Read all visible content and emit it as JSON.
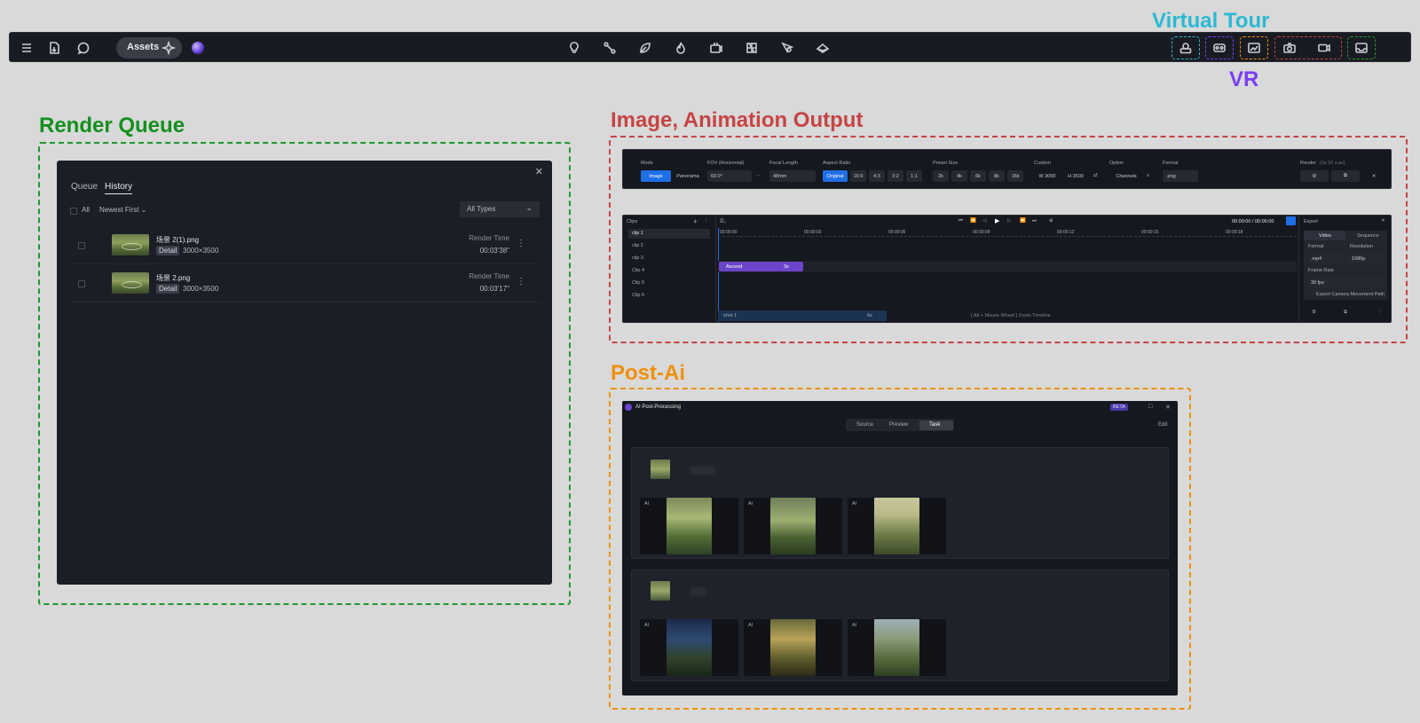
{
  "toolbar": {
    "assets_label": "Assets",
    "left_icons": [
      "menu-icon",
      "import-file-icon",
      "chat-icon",
      "sparkle-icon"
    ],
    "center_icons": [
      "light-bulb-icon",
      "path-icon",
      "leaf-icon",
      "flame-icon",
      "camera-move-icon",
      "grid-icon",
      "pin-icon",
      "layers-icon"
    ],
    "right_icons": [
      "virtual-tour-icon",
      "vr-icon",
      "share-image-icon",
      "camera-icon",
      "video-icon",
      "inbox-icon"
    ]
  },
  "annotations": {
    "virtual_tour": "Virtual Tour",
    "vr": "VR",
    "render_queue": "Render Queue",
    "image_animation": "Image, Animation Output",
    "post_ai": "Post-Ai"
  },
  "colors": {
    "virtual_tour": "#2bb9d4",
    "vr": "#7b3ff2",
    "render_queue": "#14901f",
    "image_animation": "#c64444",
    "post_ai": "#f0900e",
    "green_box": "#1e9a2a"
  },
  "render_queue": {
    "tabs": [
      "Queue",
      "History"
    ],
    "active_tab": "History",
    "filter_all": "All",
    "sort": "Newest First",
    "type_filter": "All Types",
    "items": [
      {
        "name": "场景 2(1).png",
        "badge": "Detail",
        "size": "3000×3500",
        "time_label": "Render Time",
        "time": "00:03'38\""
      },
      {
        "name": "场景 2.png",
        "badge": "Detail",
        "size": "3000×3500",
        "time_label": "Render Time",
        "time": "00:03'17\""
      }
    ]
  },
  "image_output": {
    "headers": {
      "mode": "Mode",
      "fov": "FOV (Horizontal)",
      "focal": "Focal Length",
      "aspect": "Aspect Ratio",
      "preset": "Preset Size",
      "custom": "Custom",
      "option": "Option",
      "format": "Format",
      "render": "Render"
    },
    "render_note": "(3s 32 s.av)",
    "mode_options": [
      "Image",
      "Panorama"
    ],
    "fov_value": "60.0°",
    "focal_value": "48mm",
    "aspect_options": [
      "Original",
      "16:9",
      "4:3",
      "3:2",
      "1:1"
    ],
    "preset_options": [
      "2k",
      "4k",
      "6k",
      "8k",
      "16k"
    ],
    "custom_w": "W  3000",
    "custom_h": "H  3500",
    "channels": "Channels",
    "format_value": ".png"
  },
  "animation": {
    "clips_title": "Clips",
    "clips": [
      "clip 1",
      "clip 2",
      "clip 3",
      "Clip 4",
      "Clip 5",
      "Clip 6"
    ],
    "timecode": "00:00:00 / 00:06:00",
    "ruler": [
      "00:00:00",
      "00:00:03",
      "00:00:06",
      "00:00:09",
      "00:00:12",
      "00:00:15",
      "00:00:18"
    ],
    "track_label": "Ascend",
    "track_duration": "3s",
    "shot_label": "shot 1",
    "shot_duration": "6s",
    "hint": "[ Alt + Mouse Wheel ] Zoom Timeline",
    "export": {
      "title": "Export",
      "tabs": [
        "Video",
        "Sequence"
      ],
      "format_label": "Format",
      "format_value": ".mp4",
      "resolution_label": "Resolution",
      "resolution_value": "1080p",
      "framerate_label": "Frame Rate",
      "framerate_value": "30 fps",
      "camera_path": "Export Camera Movement Path"
    }
  },
  "post_ai": {
    "title": "AI Post-Processing",
    "badge": "BETA",
    "tabs": [
      "Source",
      "Preview",
      "Task"
    ],
    "active_tab": "Task",
    "edit": "Edit",
    "ai_label": "AI"
  }
}
